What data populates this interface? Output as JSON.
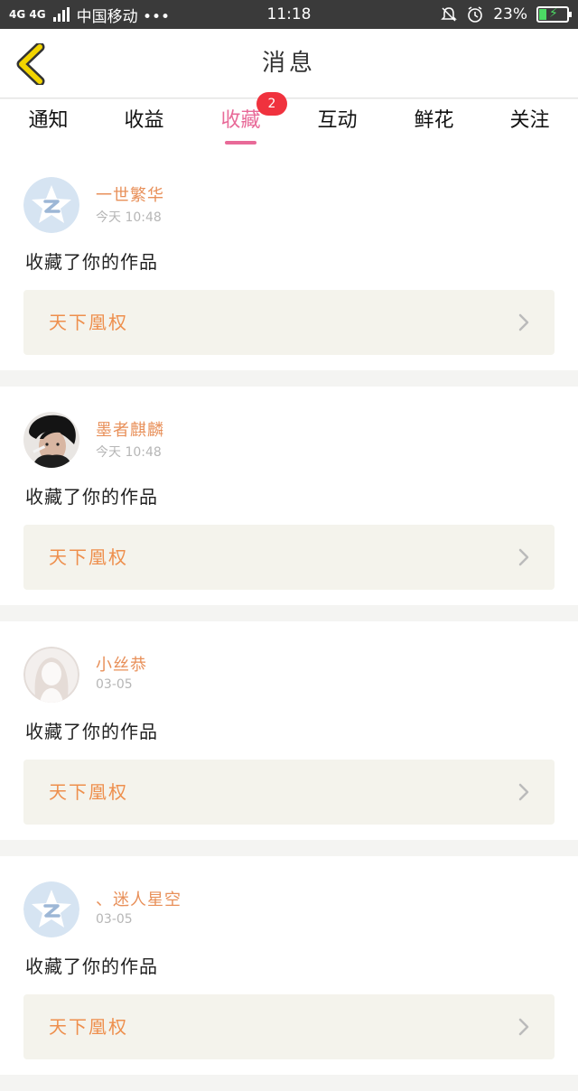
{
  "statusbar": {
    "network": "4G 4G",
    "carrier": "中国移动 •••",
    "time": "11:18",
    "battery": "23%",
    "battery_color": "#4cd964"
  },
  "header": {
    "title": "消息",
    "back_icon": "chevron-left-icon",
    "accent": "#f2d400"
  },
  "tabs": [
    {
      "label": "通知"
    },
    {
      "label": "收益"
    },
    {
      "label": "收藏",
      "badge": "2",
      "active": true
    },
    {
      "label": "互动"
    },
    {
      "label": "鲜花"
    },
    {
      "label": "关注"
    }
  ],
  "colors": {
    "active_tab": "#e86a98",
    "badge": "#f0323e",
    "username": "#e8905a",
    "work_title": "#ee8f4d"
  },
  "messages": [
    {
      "username": "一世繁华",
      "time": "今天 10:48",
      "action": "收藏了你的作品",
      "work": "天下凰权",
      "avatar": "qq-default-avatar-icon"
    },
    {
      "username": "墨者麒麟",
      "time": "今天 10:48",
      "action": "收藏了你的作品",
      "work": "天下凰权",
      "avatar": "photo-avatar"
    },
    {
      "username": "小丝恭",
      "time": "03-05",
      "action": "收藏了你的作品",
      "work": "天下凰权",
      "avatar": "female-silhouette-avatar-icon"
    },
    {
      "username": "、迷人星空",
      "time": "03-05",
      "action": "收藏了你的作品",
      "work": "天下凰权",
      "avatar": "qq-default-avatar-icon"
    }
  ]
}
